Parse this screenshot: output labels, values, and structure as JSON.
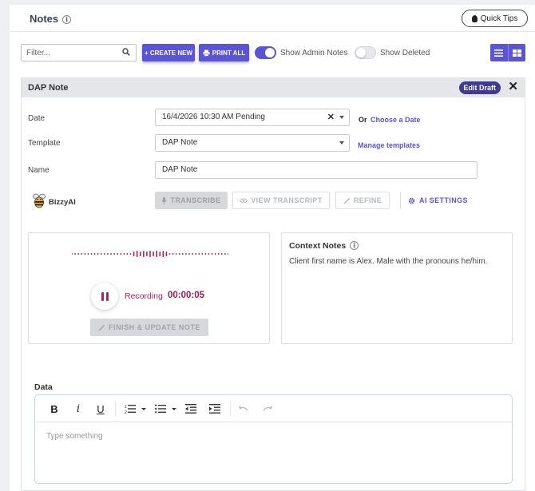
{
  "header": {
    "title": "Notes",
    "quick_tips": "Quick Tips"
  },
  "toolbar": {
    "filter_placeholder": "Filter...",
    "create_new": "+ CREATE NEW",
    "print_all": "PRINT ALL",
    "show_admin_notes": {
      "label": "Show Admin Notes",
      "on": true
    },
    "show_deleted": {
      "label": "Show Deleted",
      "on": false
    }
  },
  "note": {
    "title": "DAP Note",
    "edit_draft": "Edit Draft",
    "date_label": "Date",
    "date_value": "16/4/2026 10:30 AM Pending",
    "or": "Or",
    "choose_date": "Choose a Date",
    "template_label": "Template",
    "template_value": "DAP Note",
    "manage_templates": "Manage templates",
    "name_label": "Name",
    "name_value": "DAP Note"
  },
  "ai": {
    "brand": "BizzyAI",
    "transcribe": "TRANSCRIBE",
    "view_transcript": "VIEW TRANSCRIPT",
    "refine": "REFINE",
    "settings": "AI SETTINGS"
  },
  "recording": {
    "status": "Recording",
    "time": "00:00:05",
    "finish": "FINISH & UPDATE NOTE"
  },
  "context": {
    "title": "Context Notes",
    "text": "Client first name is Alex. Male with the pronouns he/him."
  },
  "data_section": {
    "label": "Data",
    "placeholder": "Type something"
  },
  "colors": {
    "accent": "#5b54d6",
    "recording": "#b0205a",
    "draft_badge": "#3f3a92"
  }
}
